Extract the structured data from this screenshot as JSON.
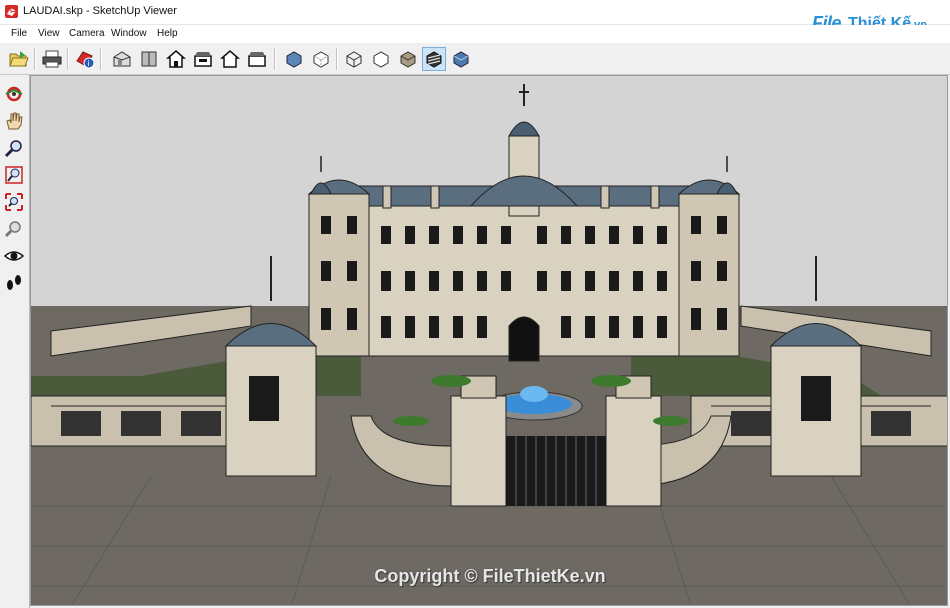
{
  "window": {
    "title": "LAUDAI.skp - SketchUp Viewer",
    "app_icon": "sketchup-logo-icon"
  },
  "brand_logo": {
    "file": "File",
    "thietke": "Thiết Kế",
    "domain": ".vn"
  },
  "menu": [
    {
      "label": "File"
    },
    {
      "label": "View"
    },
    {
      "label": "Camera"
    },
    {
      "label": "Window"
    },
    {
      "label": "Help"
    }
  ],
  "toolbar": {
    "groups": [
      [
        "open-file-icon"
      ],
      [
        "print-icon"
      ],
      [
        "model-info-icon"
      ],
      [
        "iso-view-icon",
        "top-view-icon",
        "front-view-icon",
        "right-view-icon",
        "back-view-icon",
        "left-view-icon"
      ],
      [
        "xray-icon",
        "back-edges-icon",
        "wireframe-icon",
        "hidden-line-icon",
        "shaded-icon",
        "shaded-textures-icon",
        "monochrome-icon"
      ]
    ],
    "pressed": "shaded-textures-icon"
  },
  "left_tools": [
    "orbit-icon",
    "pan-icon",
    "zoom-icon",
    "zoom-window-icon",
    "zoom-extents-icon",
    "previous-view-icon",
    "look-around-icon",
    "walk-icon"
  ],
  "viewport": {
    "watermark": "Copyright © FileThietKe.vn",
    "sky_color": "#d4d4d4",
    "ground_color": "#6e6a63",
    "lawn_color": "#4a5a3a",
    "roof_color": "#5a6e80",
    "wall_color": "#d9d2c0",
    "fountain_color": "#3a8ed8"
  }
}
